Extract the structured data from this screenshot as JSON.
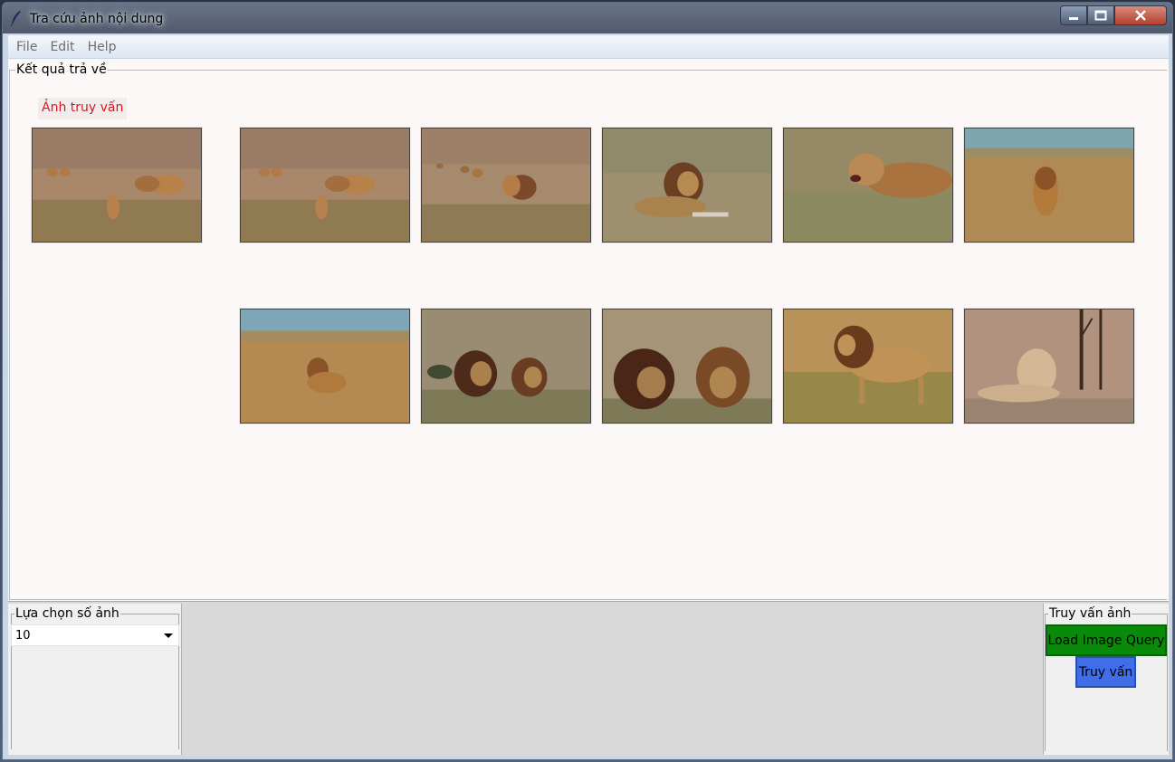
{
  "window": {
    "title": "Tra cứu ảnh nội dung",
    "minimize_icon": "minimize-icon",
    "maximize_icon": "maximize-icon",
    "close_icon": "close-icon"
  },
  "menu": {
    "items": [
      "File",
      "Edit",
      "Help"
    ]
  },
  "results": {
    "group_label": "Kết quả trả về",
    "query_label": "Ảnh truy vấn",
    "query_image": "lion-pride-in-grass-photo",
    "result_images": [
      "lion-pride-in-grass-photo",
      "lion-group-walking-photo",
      "lion-lying-in-grass-photo",
      "lioness-snarling-photo",
      "lion-walking-savanna-photo",
      "lion-sitting-savanna-photo",
      "two-lions-resting-photo",
      "two-lions-closeup-photo",
      "lion-standing-photo",
      "lioness-resting-by-tree-photo"
    ]
  },
  "count_panel": {
    "group_label": "Lựa chọn số ảnh",
    "selected_value": "10"
  },
  "query_panel": {
    "group_label": "Truy vấn ảnh",
    "load_button": "Load Image Query",
    "query_button": "Truy vấn"
  },
  "colors": {
    "query_label_text": "#e0141e",
    "load_button_bg": "#0a8a0a",
    "query_button_bg": "#3f6ee8"
  }
}
